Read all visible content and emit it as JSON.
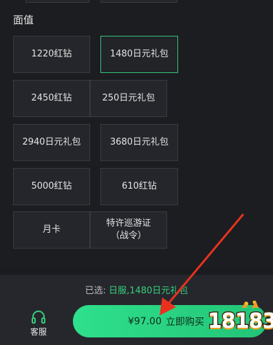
{
  "section": {
    "title": "面值"
  },
  "options": [
    {
      "label": "1220红钻",
      "selected": false
    },
    {
      "label": "1480日元礼包",
      "selected": true
    },
    {
      "label": "2450红钻",
      "selected": false
    },
    {
      "label": "250日元礼包",
      "selected": false
    },
    {
      "label": "2940日元礼包",
      "selected": false
    },
    {
      "label": "3680日元礼包",
      "selected": false
    },
    {
      "label": "5000红钻",
      "selected": false
    },
    {
      "label": "610红钻",
      "selected": false
    },
    {
      "label": "月卡",
      "selected": false
    },
    {
      "label": "特许巡游证（战令）",
      "selected": false
    }
  ],
  "summary": {
    "label": "已选:",
    "value": "日服,1480日元礼包"
  },
  "footer": {
    "service_label": "客服",
    "price": "¥97.00",
    "buy_label": "立即购买"
  },
  "watermark": {
    "text": "18183"
  },
  "colors": {
    "accent": "#35c77a",
    "background": "#1c1d21",
    "card": "#25262b",
    "button": "#2ee08c",
    "arrow": "#e8321f"
  }
}
